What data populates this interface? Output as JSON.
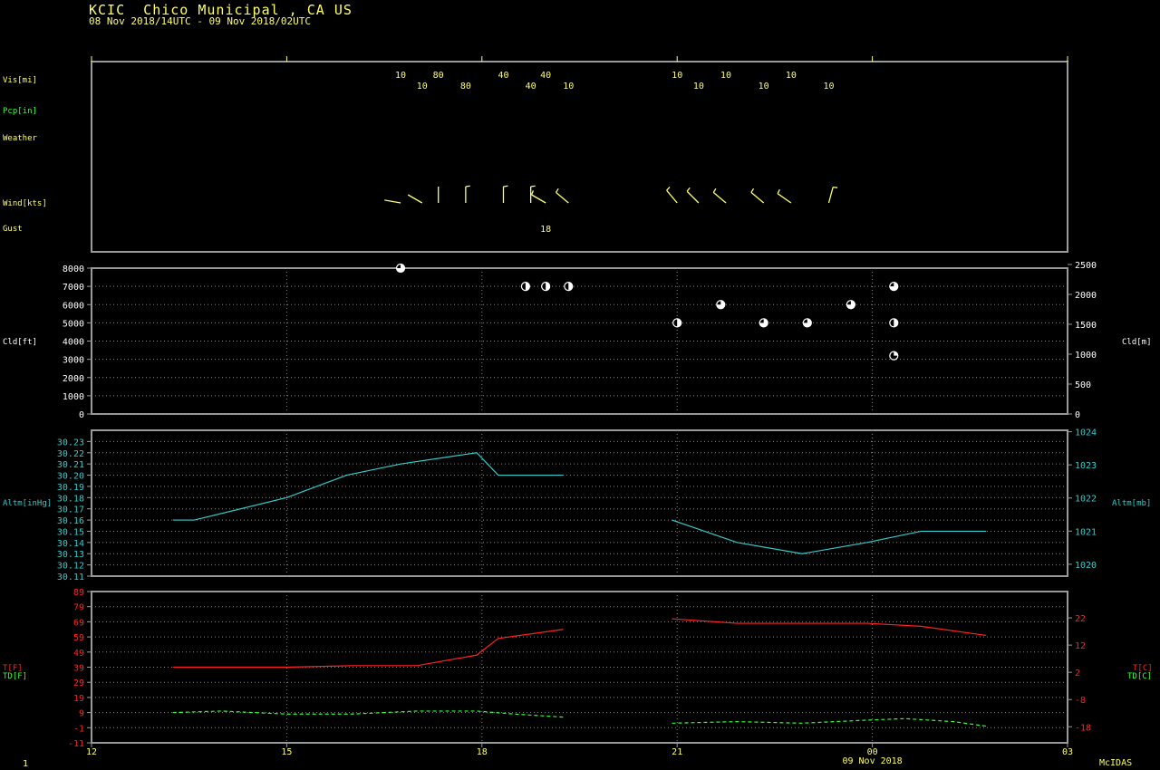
{
  "header": {
    "title": "KCIC  Chico Municipal , CA US",
    "subtitle": "08 Nov 2018/14UTC - 09 Nov 2018/02UTC"
  },
  "footer": {
    "page_number": "1",
    "brand": "McIDAS",
    "date_label": "09 Nov 2018"
  },
  "colors": {
    "yellow": "#ffff66",
    "green": "#33ff33",
    "cyan": "#33cccc",
    "red": "#ff2222",
    "white": "#ffffff",
    "frame": "#9a9a9a",
    "grid": "#8a8a8a"
  },
  "chart_data": [
    {
      "type": "table",
      "panel": "surface observations",
      "row_labels": {
        "vis": "Vis[mi]",
        "pcp": "Pcp[in]",
        "weather": "Weather",
        "wind": "Wind[kts]",
        "gust": "Gust"
      },
      "visibility": [
        {
          "hour": 16.75,
          "text": "10"
        },
        {
          "hour": 17.08,
          "text": "10"
        },
        {
          "hour": 17.33,
          "text": "80"
        },
        {
          "hour": 17.75,
          "text": "80"
        },
        {
          "hour": 18.33,
          "text": "40"
        },
        {
          "hour": 18.75,
          "text": "40"
        },
        {
          "hour": 18.98,
          "text": "40"
        },
        {
          "hour": 19.33,
          "text": "10"
        },
        {
          "hour": 21.0,
          "text": "10"
        },
        {
          "hour": 21.33,
          "text": "10"
        },
        {
          "hour": 21.75,
          "text": "10"
        },
        {
          "hour": 22.33,
          "text": "10"
        },
        {
          "hour": 22.75,
          "text": "10"
        },
        {
          "hour": 23.33,
          "text": "10"
        }
      ],
      "wind": [
        {
          "hour": 16.75,
          "dir": 280,
          "speed": 3
        },
        {
          "hour": 17.08,
          "dir": 300,
          "speed": 3
        },
        {
          "hour": 17.33,
          "dir": 360,
          "speed": 3
        },
        {
          "hour": 17.75,
          "dir": 360,
          "speed": 5
        },
        {
          "hour": 18.33,
          "dir": 360,
          "speed": 5
        },
        {
          "hour": 18.75,
          "dir": 360,
          "speed": 5
        },
        {
          "hour": 18.98,
          "dir": 300,
          "speed": 5
        },
        {
          "hour": 19.33,
          "dir": 310,
          "speed": 5
        },
        {
          "hour": 21.0,
          "dir": 320,
          "speed": 5
        },
        {
          "hour": 21.33,
          "dir": 315,
          "speed": 5
        },
        {
          "hour": 21.75,
          "dir": 310,
          "speed": 5
        },
        {
          "hour": 22.33,
          "dir": 310,
          "speed": 5
        },
        {
          "hour": 22.75,
          "dir": 305,
          "speed": 5
        },
        {
          "hour": 23.33,
          "dir": 15,
          "speed": 5
        }
      ],
      "gust": [
        {
          "hour": 18.98,
          "text": "18"
        }
      ]
    },
    {
      "type": "scatter",
      "panel": "cloud",
      "ylabel": "Cld[ft]",
      "y2label": "Cld[m]",
      "ylim": [
        0,
        8000
      ],
      "yticks": [
        0,
        1000,
        2000,
        3000,
        4000,
        5000,
        6000,
        7000,
        8000
      ],
      "y2ticks": [
        0,
        500,
        1000,
        1500,
        2000,
        2500
      ],
      "points": [
        {
          "hour": 16.75,
          "y": 8000,
          "cover": "BKN"
        },
        {
          "hour": 18.67,
          "y": 7000,
          "cover": "SCT"
        },
        {
          "hour": 18.98,
          "y": 7000,
          "cover": "SCT"
        },
        {
          "hour": 19.33,
          "y": 7000,
          "cover": "SCT"
        },
        {
          "hour": 21.0,
          "y": 5000,
          "cover": "SCT"
        },
        {
          "hour": 21.67,
          "y": 6000,
          "cover": "BKN"
        },
        {
          "hour": 22.33,
          "y": 5000,
          "cover": "BKN"
        },
        {
          "hour": 23.0,
          "y": 5000,
          "cover": "BKN"
        },
        {
          "hour": 23.67,
          "y": 6000,
          "cover": "BKN"
        },
        {
          "hour": 24.33,
          "y": 7000,
          "cover": "BKN"
        },
        {
          "hour": 24.33,
          "y": 5000,
          "cover": "SCT"
        },
        {
          "hour": 24.33,
          "y": 3200,
          "cover": "FEW"
        }
      ]
    },
    {
      "type": "line",
      "panel": "altimeter",
      "ylabel": "Altm[inHg]",
      "y2label": "Altm[mb]",
      "ylim": [
        30.11,
        30.24
      ],
      "yticks": [
        30.11,
        30.12,
        30.13,
        30.14,
        30.15,
        30.16,
        30.17,
        30.18,
        30.19,
        30.2,
        30.21,
        30.22,
        30.23
      ],
      "ytick_labels": [
        "30.11",
        "30.12",
        "30.13",
        "30.14",
        "30.15",
        "30.16",
        "30.17",
        "30.18",
        "30.19",
        "30.20",
        "30.21",
        "30.22",
        "30.23"
      ],
      "y2ticks": [
        1020,
        1021,
        1022,
        1023,
        1024
      ],
      "segments": [
        [
          {
            "hour": 13.25,
            "y": 30.16
          },
          {
            "hour": 13.58,
            "y": 30.16
          },
          {
            "hour": 15.0,
            "y": 30.18
          },
          {
            "hour": 15.92,
            "y": 30.2
          },
          {
            "hour": 16.75,
            "y": 30.21
          },
          {
            "hour": 17.92,
            "y": 30.22
          },
          {
            "hour": 18.25,
            "y": 30.2
          },
          {
            "hour": 19.25,
            "y": 30.2
          }
        ],
        [
          {
            "hour": 20.92,
            "y": 30.16
          },
          {
            "hour": 21.92,
            "y": 30.14
          },
          {
            "hour": 22.92,
            "y": 30.13
          },
          {
            "hour": 23.92,
            "y": 30.14
          },
          {
            "hour": 24.75,
            "y": 30.15
          },
          {
            "hour": 25.75,
            "y": 30.15
          }
        ]
      ]
    },
    {
      "type": "line",
      "panel": "temperature",
      "ylabel": "T[F]",
      "ylabel2": "TD[F]",
      "y2label": "T[C]",
      "y2label2": "TD[C]",
      "ylim": [
        -11,
        89
      ],
      "yticks": [
        -11,
        -1,
        9,
        19,
        29,
        39,
        49,
        59,
        69,
        79,
        89
      ],
      "y2ticks": [
        -18,
        -8,
        2,
        12,
        22
      ],
      "xlim": [
        12,
        27
      ],
      "xticks": [
        12,
        15,
        18,
        21,
        24,
        27
      ],
      "xtick_labels": [
        "12",
        "15",
        "18",
        "21",
        "00",
        "03"
      ],
      "series": [
        {
          "color": "red",
          "dashed": false,
          "segments": [
            [
              {
                "hour": 13.25,
                "y": 39
              },
              {
                "hour": 15.0,
                "y": 39
              },
              {
                "hour": 16.0,
                "y": 40
              },
              {
                "hour": 17.0,
                "y": 40
              },
              {
                "hour": 17.92,
                "y": 47
              },
              {
                "hour": 18.25,
                "y": 58
              },
              {
                "hour": 19.25,
                "y": 64
              }
            ],
            [
              {
                "hour": 20.92,
                "y": 71
              },
              {
                "hour": 21.92,
                "y": 68
              },
              {
                "hour": 23.92,
                "y": 68
              },
              {
                "hour": 24.75,
                "y": 66
              },
              {
                "hour": 25.75,
                "y": 60
              }
            ]
          ]
        },
        {
          "color": "green",
          "dashed": true,
          "segments": [
            [
              {
                "hour": 13.25,
                "y": 9
              },
              {
                "hour": 14.0,
                "y": 10
              },
              {
                "hour": 15.0,
                "y": 8
              },
              {
                "hour": 16.0,
                "y": 8
              },
              {
                "hour": 17.0,
                "y": 10
              },
              {
                "hour": 17.92,
                "y": 10
              },
              {
                "hour": 18.5,
                "y": 8
              },
              {
                "hour": 19.25,
                "y": 6
              }
            ],
            [
              {
                "hour": 20.92,
                "y": 2
              },
              {
                "hour": 21.92,
                "y": 3
              },
              {
                "hour": 22.92,
                "y": 2
              },
              {
                "hour": 23.92,
                "y": 4
              },
              {
                "hour": 24.5,
                "y": 5
              },
              {
                "hour": 25.25,
                "y": 3
              },
              {
                "hour": 25.75,
                "y": 0
              }
            ]
          ]
        }
      ]
    }
  ]
}
